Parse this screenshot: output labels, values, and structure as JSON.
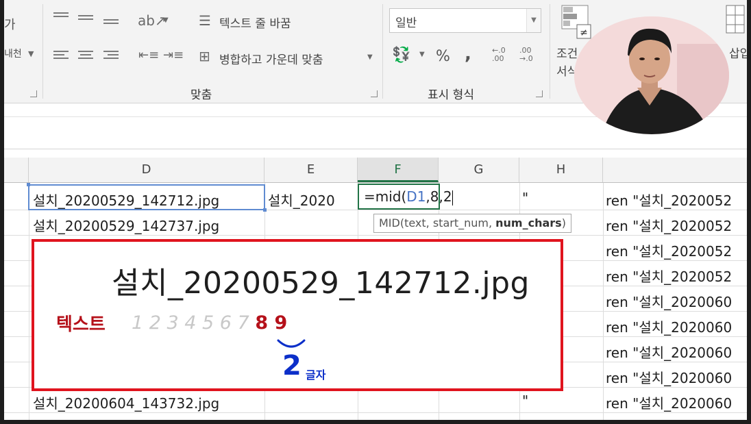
{
  "ribbon": {
    "wrap_text": "텍스트 줄 바꿈",
    "merge_center": "병합하고 가운데 맞춤",
    "align_group": "맞춤",
    "number_format": "일반",
    "percent": "%",
    "comma": ",",
    "number_group": "표시 형식",
    "cond_format_line1": "조건",
    "cond_format_line2": "서식",
    "insert_label": "삽입",
    "cut_label_1": "가",
    "cut_label_2": "내천"
  },
  "columns": [
    "D",
    "E",
    "F",
    "G",
    "H"
  ],
  "active_column": "F",
  "cells": {
    "d1": "설치_20200529_142712.jpg",
    "d2": "설치_20200529_142737.jpg",
    "d9": "설치_20200604_143732.jpg",
    "e1": "설치_2020",
    "h1": "\"",
    "h9": "\"",
    "i_col": [
      "ren \"설치_2020052",
      "ren \"설치_2020052",
      "ren \"설치_2020052",
      "ren \"설치_2020052",
      "ren \"설치_2020060",
      "ren \"설치_2020060",
      "ren \"설치_2020060",
      "ren \"설치_2020060",
      "ren \"설치_2020060"
    ]
  },
  "editor": {
    "prefix": "=mid(",
    "ref": "D1",
    "suffix": ",8,2"
  },
  "tooltip": {
    "text": "MID(text, start_num, ",
    "bold": "num_chars",
    "close": ")"
  },
  "callout": {
    "filename": "설치_20200529_142712.jpg",
    "label": "텍스트",
    "digits": "1  2  3 4 5 6 7",
    "highlight": "8 9",
    "count": "2",
    "unit": "글자",
    "border_color": "#e0141e"
  },
  "colors": {
    "excel_green": "#217346",
    "ref_blue": "#4472c4",
    "annot_blue": "#0c2fc9",
    "annot_red": "#b5111a"
  }
}
